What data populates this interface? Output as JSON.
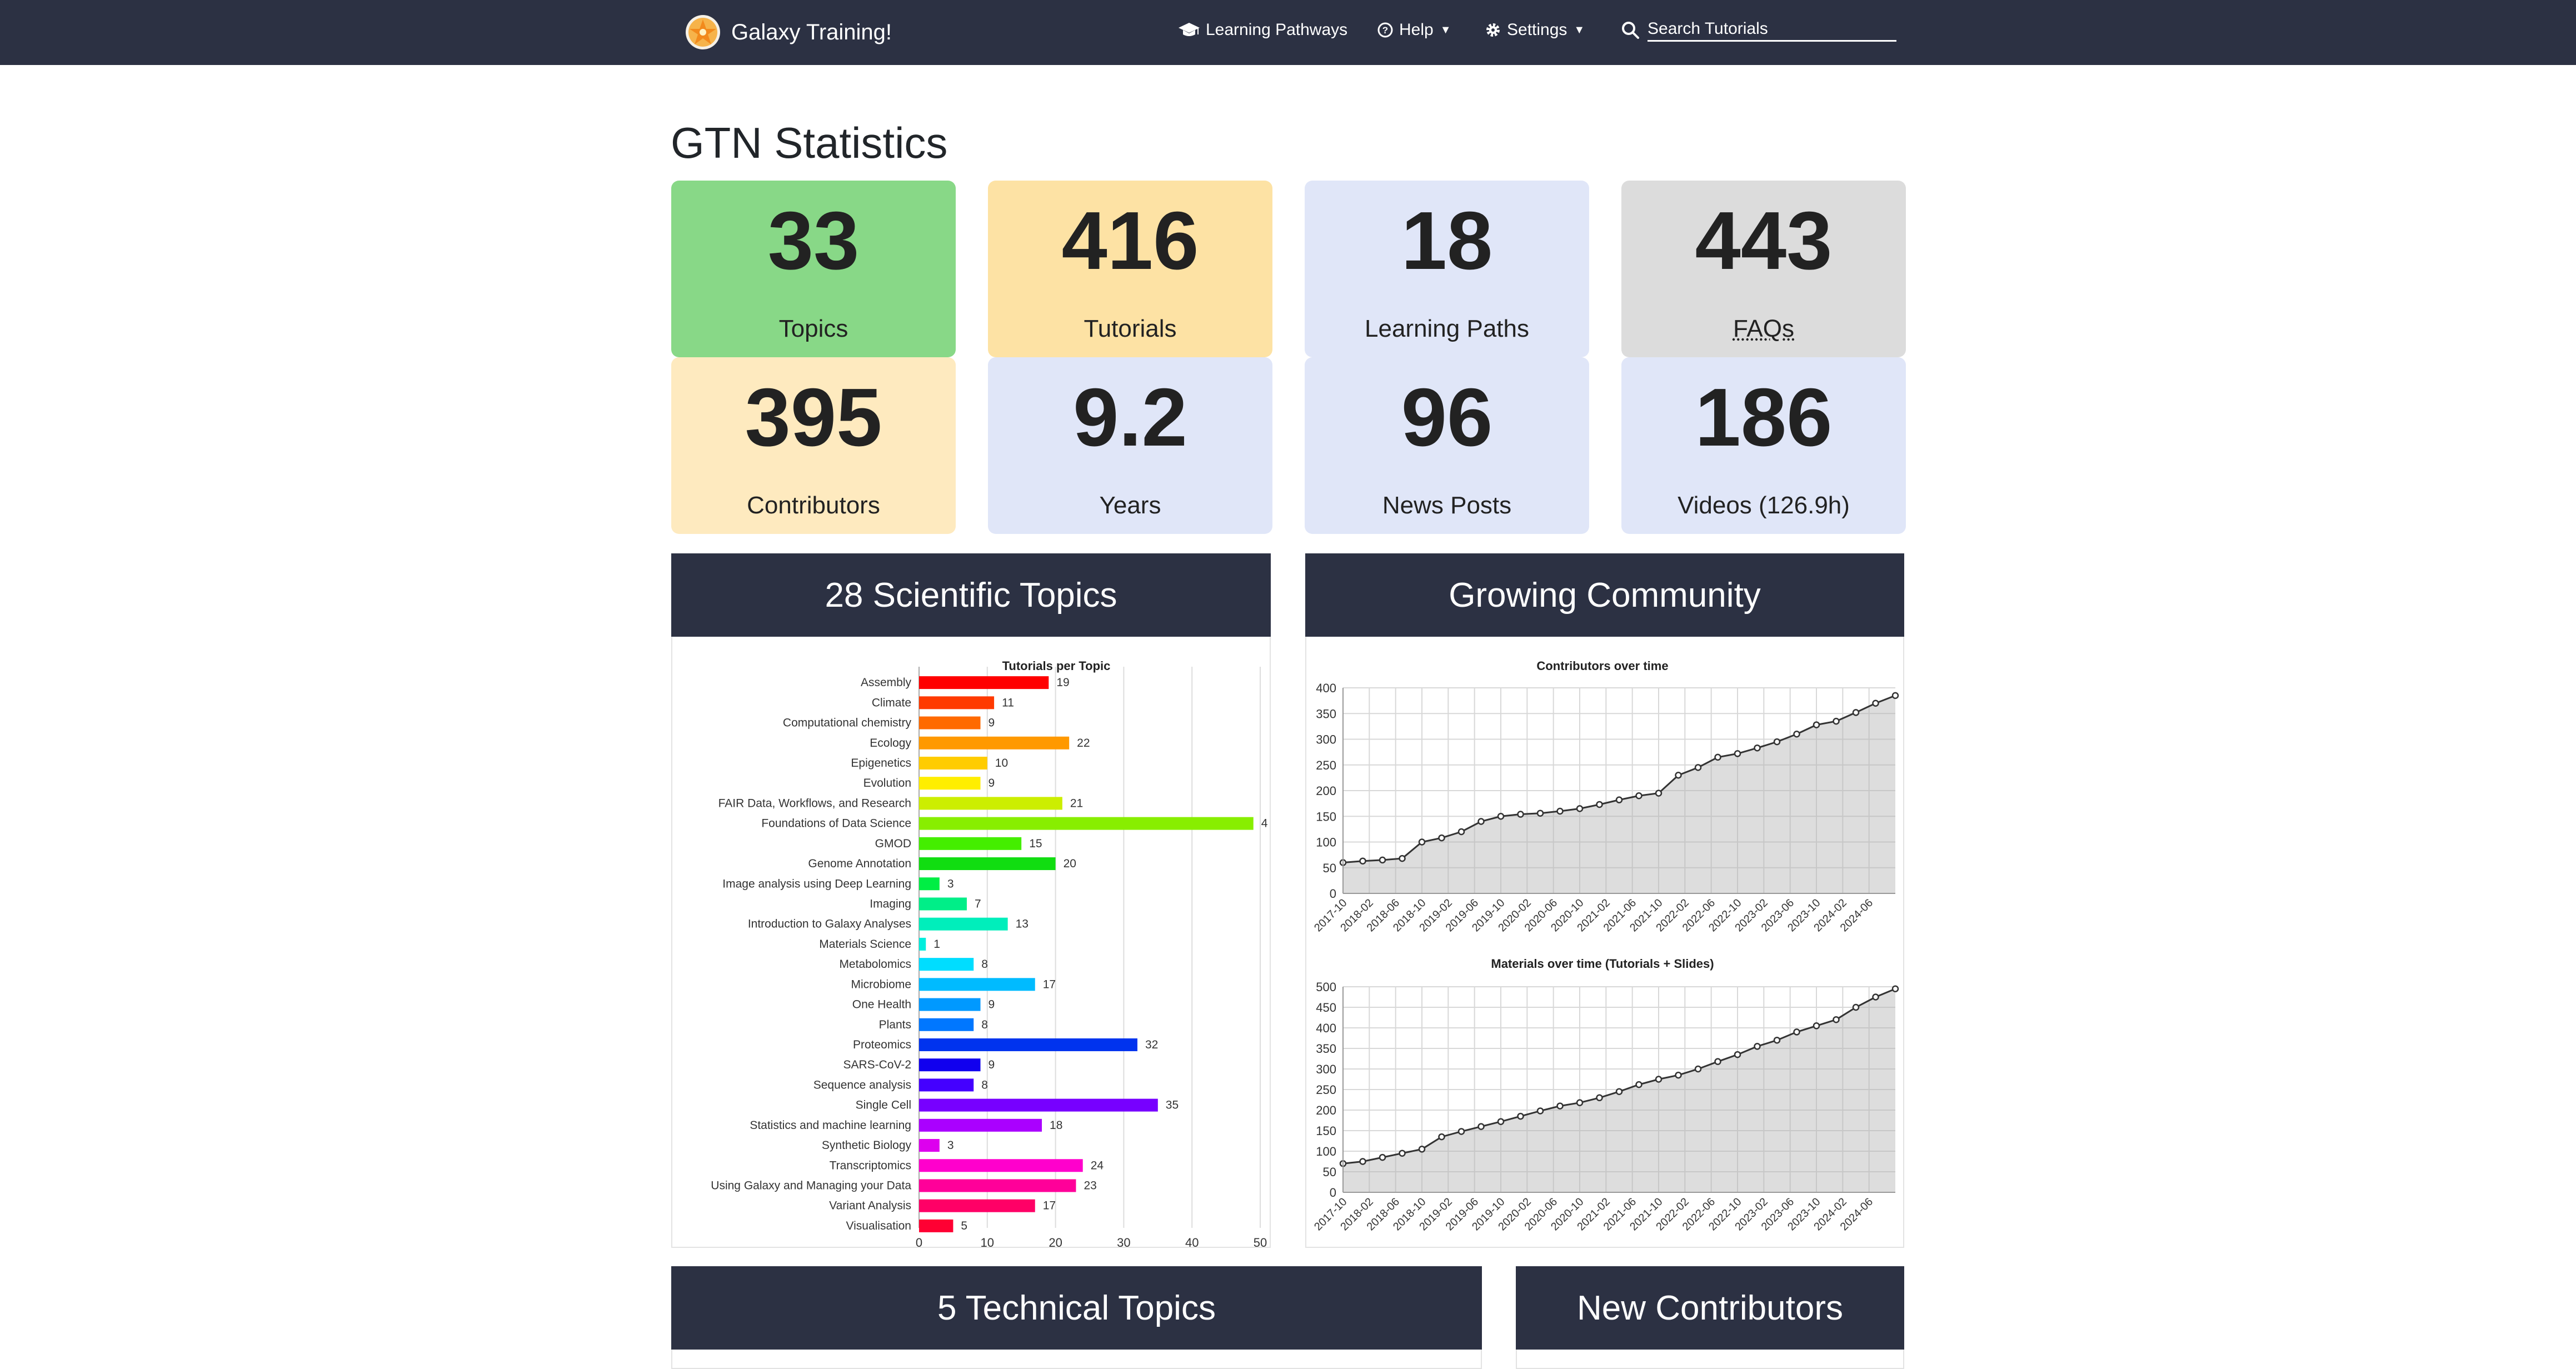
{
  "navbar": {
    "brand": "Galaxy Training!",
    "learning_pathways": "Learning Pathways",
    "help": "Help",
    "settings": "Settings",
    "search_value": "Search Tutorials"
  },
  "page_title": "GTN Statistics",
  "stats": [
    {
      "value": "33",
      "label": "Topics",
      "color": "#88d887"
    },
    {
      "value": "416",
      "label": "Tutorials",
      "color": "#fde2a4"
    },
    {
      "value": "18",
      "label": "Learning Paths",
      "color": "#e0e6f8"
    },
    {
      "value": "443",
      "label": "FAQs",
      "color": "#dcdcdc"
    },
    {
      "value": "395",
      "label": "Contributors",
      "color": "#feeabf"
    },
    {
      "value": "9.2",
      "label": "Years",
      "color": "#e0e6f8"
    },
    {
      "value": "96",
      "label": "News Posts",
      "color": "#e0e6f8"
    },
    {
      "value": "186",
      "label": "Videos (126.9h)",
      "color": "#e0e6f8"
    }
  ],
  "panels": {
    "scientific": "28 Scientific Topics",
    "community": "Growing Community",
    "technical": "5 Technical Topics",
    "new_contributors": "New Contributors"
  },
  "chart_data": [
    {
      "type": "bar",
      "orientation": "horizontal",
      "title": "Tutorials per Topic",
      "categories": [
        "Assembly",
        "Climate",
        "Computational chemistry",
        "Ecology",
        "Epigenetics",
        "Evolution",
        "FAIR Data, Workflows, and Research",
        "Foundations of Data Science",
        "GMOD",
        "Genome Annotation",
        "Image analysis using Deep Learning",
        "Imaging",
        "Introduction to Galaxy Analyses",
        "Materials Science",
        "Metabolomics",
        "Microbiome",
        "One Health",
        "Plants",
        "Proteomics",
        "SARS-CoV-2",
        "Sequence analysis",
        "Single Cell",
        "Statistics and machine learning",
        "Synthetic Biology",
        "Transcriptomics",
        "Using Galaxy and Managing your Data",
        "Variant Analysis",
        "Visualisation"
      ],
      "values": [
        19,
        11,
        9,
        22,
        10,
        9,
        21,
        49,
        15,
        20,
        3,
        7,
        13,
        1,
        8,
        17,
        9,
        8,
        32,
        9,
        8,
        35,
        18,
        3,
        24,
        23,
        17,
        5
      ],
      "value_labels": [
        "19",
        "11",
        "9",
        "22",
        "10",
        "9",
        "21",
        "4",
        "15",
        "20",
        "3",
        "7",
        "13",
        "1",
        "8",
        "17",
        "9",
        "8",
        "32",
        "9",
        "8",
        "35",
        "18",
        "3",
        "24",
        "23",
        "17",
        "5"
      ],
      "colors": [
        "#ff0000",
        "#ff3a00",
        "#ff6a00",
        "#ff9900",
        "#ffcc00",
        "#ffee00",
        "#ccee00",
        "#88ee00",
        "#44ee00",
        "#11dd11",
        "#00ee44",
        "#00ee88",
        "#00eebb",
        "#00eedd",
        "#00ddff",
        "#00bbff",
        "#0099ff",
        "#0077ff",
        "#0033ee",
        "#1100ee",
        "#4400ff",
        "#7700ff",
        "#aa00ff",
        "#dd00ee",
        "#ff00cc",
        "#ff0099",
        "#ff0066",
        "#ff0033"
      ],
      "xticks": [
        "0",
        "10",
        "20",
        "30",
        "40",
        "50"
      ],
      "xlim": [
        0,
        50
      ],
      "grid": true
    },
    {
      "type": "area",
      "title": "Contributors over time",
      "x": [
        "2017-10",
        "2018-01",
        "2018-04",
        "2018-07",
        "2018-10",
        "2019-01",
        "2019-04",
        "2019-07",
        "2019-10",
        "2020-01",
        "2020-04",
        "2020-07",
        "2020-10",
        "2021-01",
        "2021-04",
        "2021-07",
        "2021-10",
        "2022-01",
        "2022-04",
        "2022-07",
        "2022-10",
        "2023-01",
        "2023-04",
        "2023-07",
        "2023-10",
        "2024-01",
        "2024-04",
        "2024-07",
        "2024-10"
      ],
      "y": [
        60,
        63,
        65,
        68,
        100,
        108,
        120,
        140,
        150,
        154,
        156,
        160,
        165,
        173,
        182,
        190,
        195,
        230,
        245,
        265,
        272,
        283,
        295,
        310,
        328,
        335,
        352,
        370,
        385
      ],
      "xticks": [
        "2017-10",
        "2018-02",
        "2018-06",
        "2018-10",
        "2019-02",
        "2019-06",
        "2019-10",
        "2020-02",
        "2020-06",
        "2020-10",
        "2021-02",
        "2021-06",
        "2021-10",
        "2022-02",
        "2022-06",
        "2022-10",
        "2023-02",
        "2023-06",
        "2023-10",
        "2024-02",
        "2024-06"
      ],
      "yticks": [
        "0",
        "50",
        "100",
        "150",
        "200",
        "250",
        "300",
        "350",
        "400"
      ],
      "ylim": [
        0,
        400
      ],
      "grid": true
    },
    {
      "type": "area",
      "title": "Materials over time (Tutorials + Slides)",
      "x": [
        "2017-10",
        "2018-01",
        "2018-04",
        "2018-07",
        "2018-10",
        "2019-01",
        "2019-04",
        "2019-07",
        "2019-10",
        "2020-01",
        "2020-04",
        "2020-07",
        "2020-10",
        "2021-01",
        "2021-04",
        "2021-07",
        "2021-10",
        "2022-01",
        "2022-04",
        "2022-07",
        "2022-10",
        "2023-01",
        "2023-04",
        "2023-07",
        "2023-10",
        "2024-01",
        "2024-04",
        "2024-07",
        "2024-10"
      ],
      "y": [
        70,
        75,
        85,
        95,
        105,
        135,
        148,
        160,
        172,
        185,
        198,
        210,
        218,
        230,
        245,
        262,
        275,
        285,
        300,
        318,
        335,
        355,
        370,
        390,
        405,
        420,
        450,
        475,
        495
      ],
      "xticks": [
        "2017-10",
        "2018-02",
        "2018-06",
        "2018-10",
        "2019-02",
        "2019-06",
        "2019-10",
        "2020-02",
        "2020-06",
        "2020-10",
        "2021-02",
        "2021-06",
        "2021-10",
        "2022-02",
        "2022-06",
        "2022-10",
        "2023-02",
        "2023-06",
        "2023-10",
        "2024-02",
        "2024-06"
      ],
      "yticks": [
        "0",
        "50",
        "100",
        "150",
        "200",
        "250",
        "300",
        "350",
        "400",
        "450",
        "500"
      ],
      "ylim": [
        0,
        500
      ],
      "grid": true
    }
  ]
}
